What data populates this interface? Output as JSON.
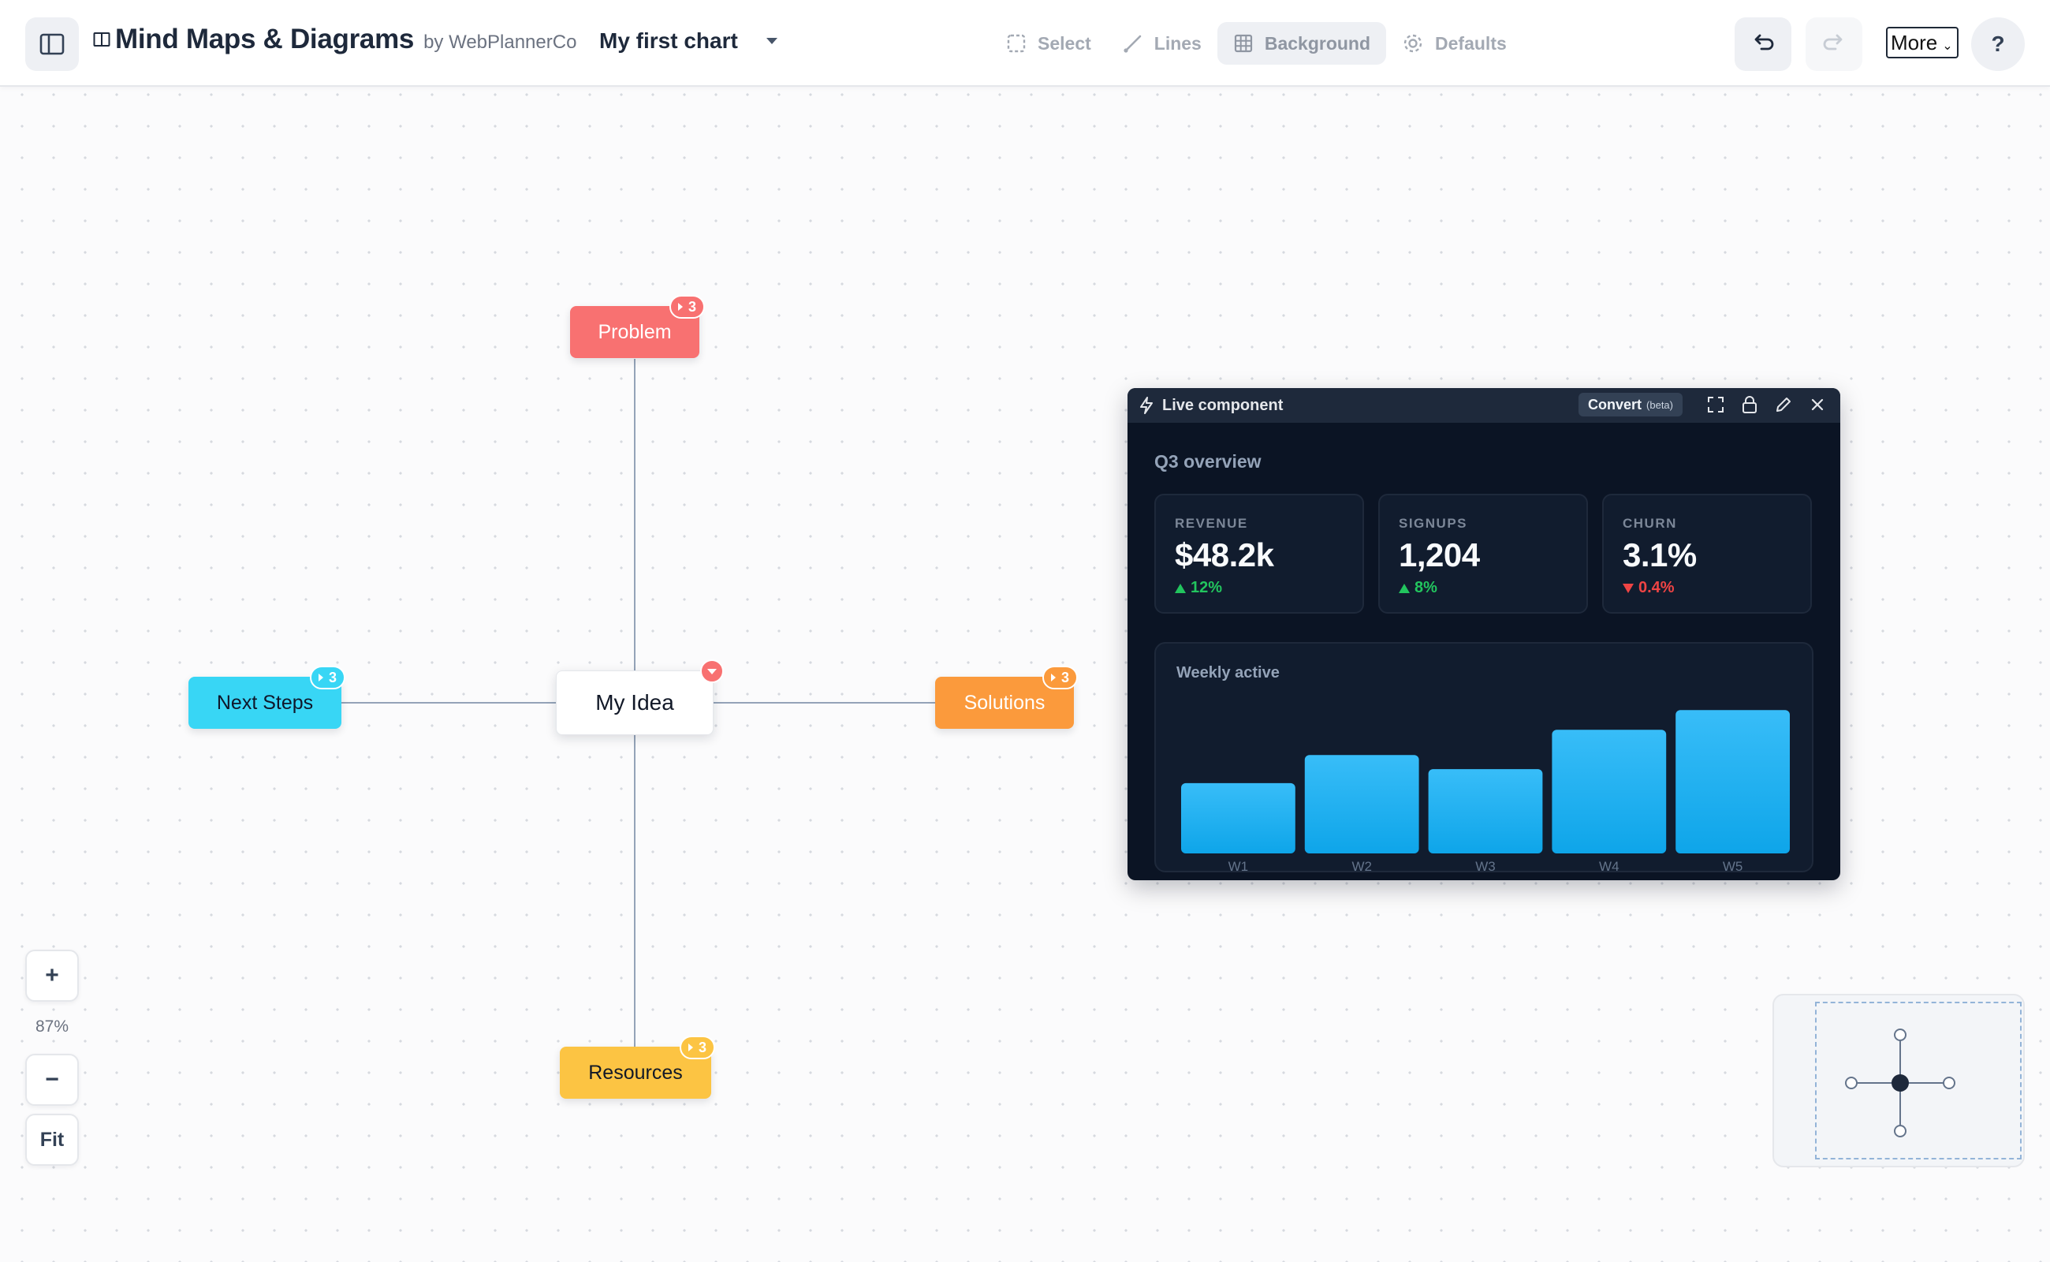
{
  "header": {
    "brand_name": "Mind Maps & Diagrams",
    "brand_by": "by WebPlannerCo",
    "doc_title": "My first chart",
    "tools": [
      {
        "label": "Select",
        "icon": "select-icon"
      },
      {
        "label": "Lines",
        "icon": "lines-icon"
      },
      {
        "label": "Background",
        "icon": "grid-icon"
      },
      {
        "label": "Defaults",
        "icon": "gear-icon"
      }
    ],
    "more_label": "More",
    "help_label": "?"
  },
  "mindmap": {
    "center": "My Idea",
    "nodes": {
      "problem": {
        "label": "Problem",
        "count": "3",
        "color": "#f87171"
      },
      "next_steps": {
        "label": "Next Steps",
        "count": "3",
        "color": "#38d6f5"
      },
      "solutions": {
        "label": "Solutions",
        "count": "3",
        "color": "#fb9a3c"
      },
      "resources": {
        "label": "Resources",
        "count": "3",
        "color": "#fcc443"
      }
    }
  },
  "live_component": {
    "title": "Live component",
    "convert_label": "Convert",
    "beta_label": "(beta)",
    "heading": "Q3 overview",
    "kpis": [
      {
        "label": "REVENUE",
        "value": "$48.2k",
        "delta": "12%",
        "direction": "up"
      },
      {
        "label": "SIGNUPS",
        "value": "1,204",
        "delta": "8%",
        "direction": "up"
      },
      {
        "label": "CHURN",
        "value": "3.1%",
        "delta": "0.4%",
        "direction": "down"
      }
    ],
    "chart_title": "Weekly active"
  },
  "chart_data": {
    "type": "bar",
    "title": "Weekly active",
    "categories": [
      "W1",
      "W2",
      "W3",
      "W4",
      "W5"
    ],
    "values": [
      50,
      70,
      60,
      88,
      102
    ],
    "ylim": [
      0,
      110
    ],
    "grid": false,
    "color": "#38bdf8"
  },
  "zoom": {
    "plus": "+",
    "minus": "−",
    "level": "87%",
    "fit": "Fit"
  }
}
